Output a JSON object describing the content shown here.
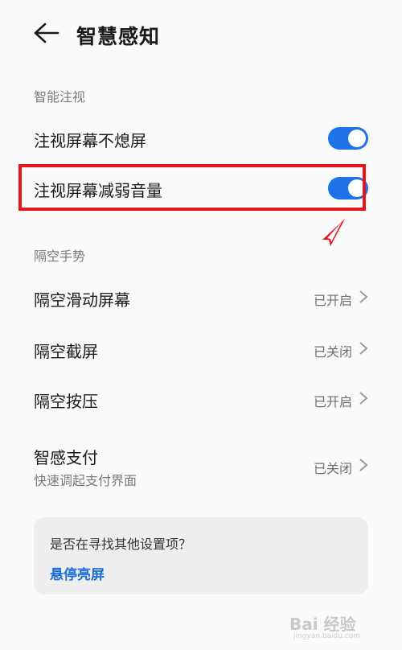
{
  "header": {
    "title": "智慧感知"
  },
  "sections": {
    "smart_gaze": {
      "label": "智能注视",
      "items": [
        {
          "label": "注视屏幕不熄屏",
          "toggle_on": true
        },
        {
          "label": "注视屏幕减弱音量",
          "toggle_on": true
        }
      ]
    },
    "air_gesture": {
      "label": "隔空手势",
      "items": [
        {
          "label": "隔空滑动屏幕",
          "value": "已开启"
        },
        {
          "label": "隔空截屏",
          "value": "已关闭"
        },
        {
          "label": "隔空按压",
          "value": "已开启"
        },
        {
          "label": "智感支付",
          "sublabel": "快速调起支付界面",
          "value": "已关闭"
        }
      ]
    }
  },
  "suggestion": {
    "question": "是否在寻找其他设置项？",
    "link": "悬停亮屏"
  },
  "watermark": {
    "text": "Bai 经验",
    "sub": "jingyan.baidu.com"
  },
  "colors": {
    "accent": "#1e73e8",
    "highlight": "#e8141c",
    "link": "#1a6fd6"
  }
}
